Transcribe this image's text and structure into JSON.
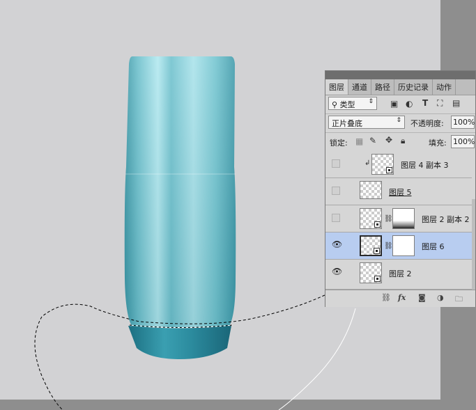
{
  "panel": {
    "tabs": [
      "图层",
      "通道",
      "路径",
      "历史记录",
      "动作"
    ],
    "filter_label": "类型",
    "blend_mode": "正片叠底",
    "opacity_label": "不透明度:",
    "opacity_value": "100%",
    "lock_label": "锁定:",
    "fill_label": "填充:",
    "fill_value": "100%"
  },
  "layers": [
    {
      "name": "图层 4 副本 3",
      "visible": false,
      "selected": false
    },
    {
      "name": "图层 5",
      "visible": false,
      "selected": false
    },
    {
      "name": "图层 2 副本 2",
      "visible": false,
      "selected": false
    },
    {
      "name": "图层 6",
      "visible": true,
      "selected": true
    },
    {
      "name": "图层 2",
      "visible": true,
      "selected": false
    }
  ],
  "icons": {
    "search": "magnifier-icon",
    "visibility": "eye-icon",
    "link": "chain-link-icon",
    "fx": "fx-icon",
    "mask": "add-mask-icon",
    "adjustment": "adjustment-layer-icon",
    "group": "folder-icon"
  },
  "colors": {
    "canvas": "#d2d2d4",
    "bottle_light": "#9fdde4",
    "bottle_dark": "#2a8294",
    "selected_layer": "#b8cdf0"
  }
}
